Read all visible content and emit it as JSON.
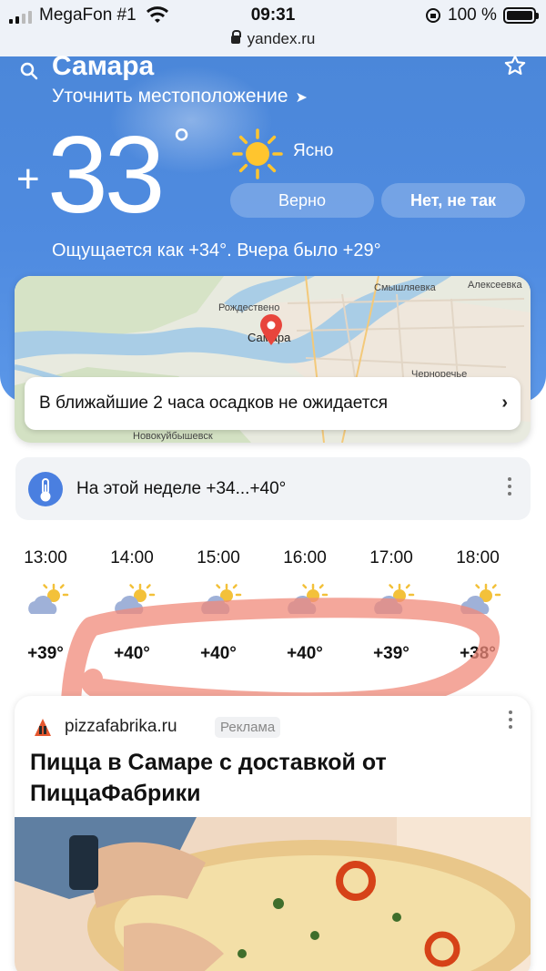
{
  "status_bar": {
    "carrier": "MegaFon #1",
    "time": "09:31",
    "battery": "100 %",
    "url": "yandex.ru"
  },
  "weather": {
    "city": "Самара",
    "refine_location": "Уточнить местоположение",
    "temp_sign": "+",
    "temp_value": "33",
    "temp_unit": "°",
    "condition": "Ясно",
    "confirm_yes": "Верно",
    "confirm_no": "Нет, не так",
    "feels_like": "Ощущается как +34°. Вчера было +29°"
  },
  "map": {
    "labels": [
      "Рождествено",
      "Смышляевка",
      "Алексеевка",
      "Самара",
      "Черноречье",
      "Новокуйбышевск"
    ],
    "rain_notice": "В ближайшие 2 часа осадков не ожидается"
  },
  "week": {
    "text": "На этой неделе +34...+40°"
  },
  "hourly": [
    {
      "time": "13:00",
      "temp": "+39°",
      "icon": "partly-cloudy-icon"
    },
    {
      "time": "14:00",
      "temp": "+40°",
      "icon": "partly-cloudy-icon"
    },
    {
      "time": "15:00",
      "temp": "+40°",
      "icon": "partly-cloudy-icon"
    },
    {
      "time": "16:00",
      "temp": "+40°",
      "icon": "partly-cloudy-icon"
    },
    {
      "time": "17:00",
      "temp": "+39°",
      "icon": "partly-cloudy-icon"
    },
    {
      "time": "18:00",
      "temp": "+38°",
      "icon": "partly-cloudy-icon"
    }
  ],
  "ad": {
    "domain": "pizzafabrika.ru",
    "badge": "Реклама",
    "title": "Пицца в Самаре с доставкой от ПиццаФабрики"
  },
  "colors": {
    "hero": "#4f8be0",
    "annotation_stroke": "#f08a7a"
  }
}
